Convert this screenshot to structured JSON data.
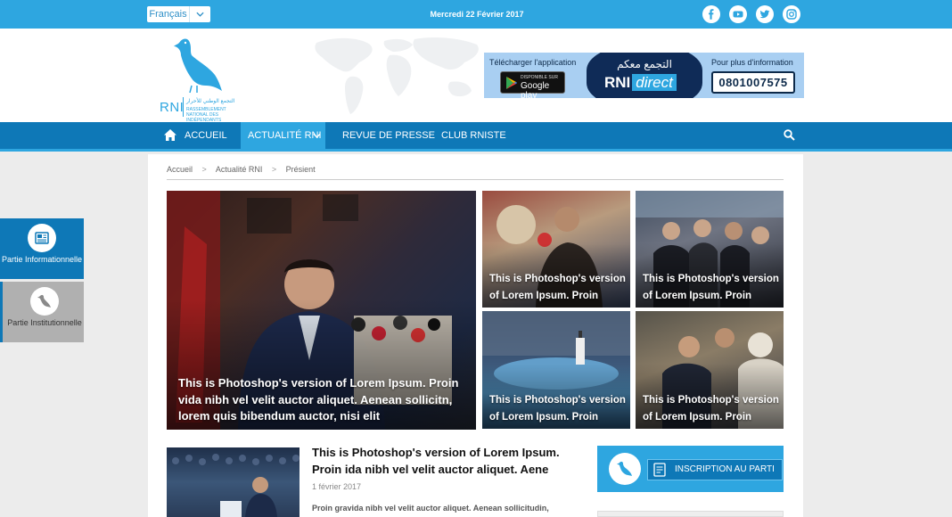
{
  "topbar": {
    "language": "Français",
    "date": "Mercredi 22 Février 2017",
    "social": [
      "facebook-icon",
      "youtube-icon",
      "twitter-icon",
      "instagram-icon"
    ]
  },
  "logo": {
    "name": "RNI",
    "arabic": "التجمع الوطني للأحرار",
    "french": "RASSEMBLEMENT NATIONAL DES INDÉPENDANTS"
  },
  "banner": {
    "download_label": "Télécharger l'application",
    "store_small": "DISPONIBLE SUR",
    "store_name": "Google play",
    "arabic": "التجمع معكم",
    "brand": "RNI",
    "brand_suffix": "direct",
    "info_label": "Pour plus d'information",
    "phone": "0801007575"
  },
  "nav": {
    "items": [
      "ACCUEIL",
      "ACTUALITÉ RNI",
      "REVUE DE PRESSE",
      "CLUB RNISTE"
    ]
  },
  "breadcrumb": [
    "Accueil",
    "Actualité RNI",
    "Présient"
  ],
  "featured": {
    "main_caption": "This is Photoshop's version  of Lorem Ipsum. Proin vida nibh vel velit auctor aliquet. Aenean sollicitn, lorem quis bibendum auctor, nisi elit",
    "small_captions": [
      "This is Photoshop's version of Lorem Ipsum. Proin",
      "This is Photoshop's version of Lorem Ipsum. Proin",
      "This is Photoshop's version of Lorem Ipsum. Proin",
      "This is Photoshop's version of Lorem Ipsum. Proin"
    ]
  },
  "sidetabs": [
    {
      "label": "Partie Informationnelle"
    },
    {
      "label": "Partie Institutionnelle"
    }
  ],
  "article": {
    "title": "This is Photoshop's version  of Lorem Ipsum. Proin ida nibh vel velit auctor aliquet. Aene",
    "date": "1 février 2017",
    "excerpt": "Proin gravida nibh vel velit auctor aliquet. Aenean sollicitudin,"
  },
  "cta": {
    "label": "INSCRIPTION AU PARTI"
  },
  "colors": {
    "topbar": "#2ea6e0",
    "nav": "#0e78b7",
    "active_tab": "#2ea6e0"
  }
}
